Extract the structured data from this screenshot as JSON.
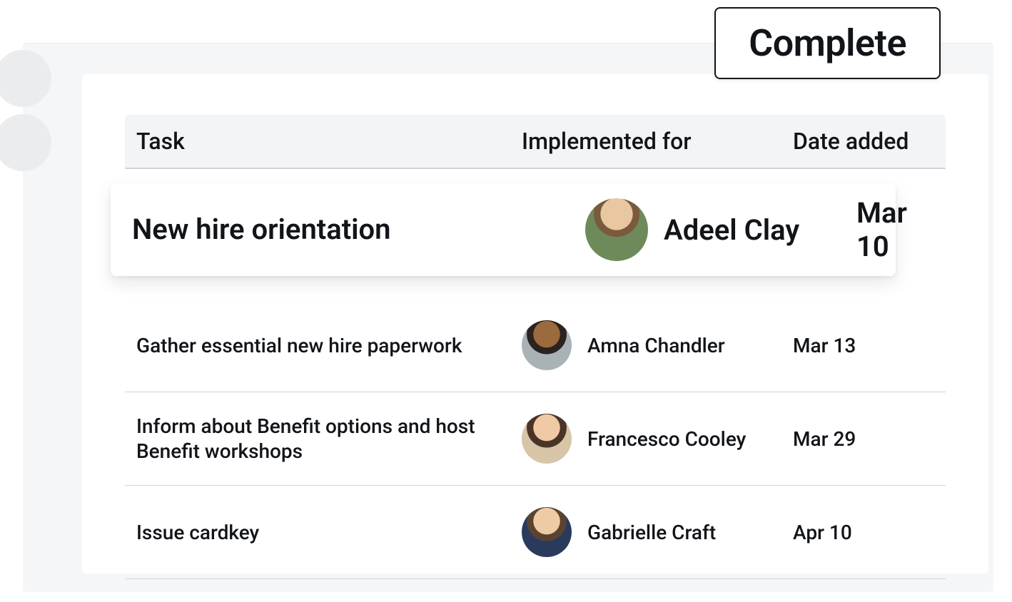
{
  "badge": {
    "label": "Complete"
  },
  "table": {
    "columns": {
      "task": "Task",
      "implemented_for": "Implemented for",
      "date_added": "Date added"
    },
    "rows": [
      {
        "task": "New hire orientation",
        "person": "Adeel Clay",
        "date": "Mar 10",
        "highlighted": true,
        "avatar": "avatar-adeel-clay"
      },
      {
        "task": "Gather essential new hire paperwork",
        "person": "Amna Chandler",
        "date": "Mar 13",
        "highlighted": false,
        "avatar": "avatar-amna-chandler"
      },
      {
        "task": "Inform about Benefit options and host Benefit workshops",
        "person": "Francesco Cooley",
        "date": "Mar 29",
        "highlighted": false,
        "avatar": "avatar-francesco-cooley"
      },
      {
        "task": "Issue cardkey",
        "person": "Gabrielle Craft",
        "date": "Apr 10",
        "highlighted": false,
        "avatar": "avatar-gabrielle-craft"
      }
    ]
  }
}
